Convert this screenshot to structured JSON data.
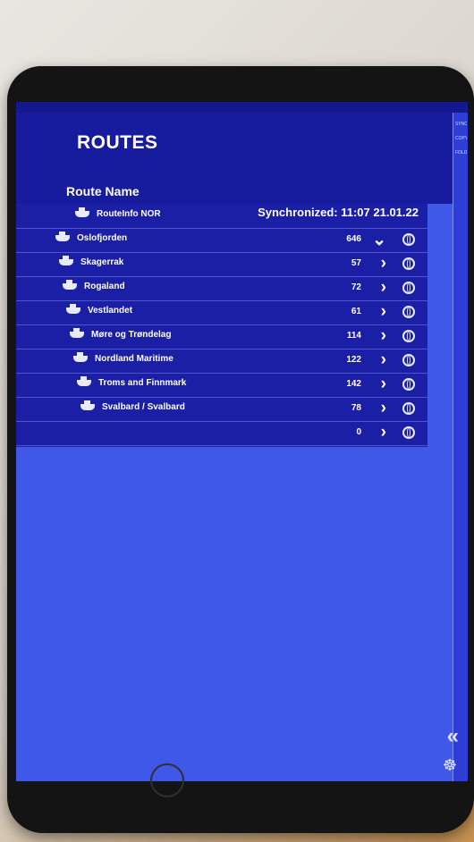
{
  "header": {
    "title": "ROUTES",
    "column_label": "Route Name",
    "sync_text": "Synchronized: 11:07 21.01.22"
  },
  "right_panel": {
    "items": [
      "SYNC",
      "COPY T",
      "FOLDE"
    ]
  },
  "routes": [
    {
      "name": "RouteInfo NOR",
      "count": "",
      "expanded": false
    },
    {
      "name": "Oslofjorden",
      "count": "646",
      "expanded": true
    },
    {
      "name": "Skagerrak",
      "count": "57",
      "expanded": false
    },
    {
      "name": "Rogaland",
      "count": "72",
      "expanded": false
    },
    {
      "name": "Vestlandet",
      "count": "61",
      "expanded": false
    },
    {
      "name": "Møre og Trøndelag",
      "count": "114",
      "expanded": false
    },
    {
      "name": "Nordland Maritime",
      "count": "122",
      "expanded": false
    },
    {
      "name": "Troms and Finnmark",
      "count": "142",
      "expanded": false
    },
    {
      "name": "Svalbard / Svalbard",
      "count": "78",
      "expanded": false
    },
    {
      "name": "",
      "count": "0",
      "expanded": false
    }
  ],
  "icons": {
    "back": "double-chevron-left-icon",
    "settings": "ship-wheel-icon",
    "route": "ship-icon",
    "globe": "globe-icon"
  },
  "colors": {
    "header": "#171b9e",
    "background": "#3f58e8",
    "list": "#1b1fa6",
    "text": "#ffffff"
  }
}
